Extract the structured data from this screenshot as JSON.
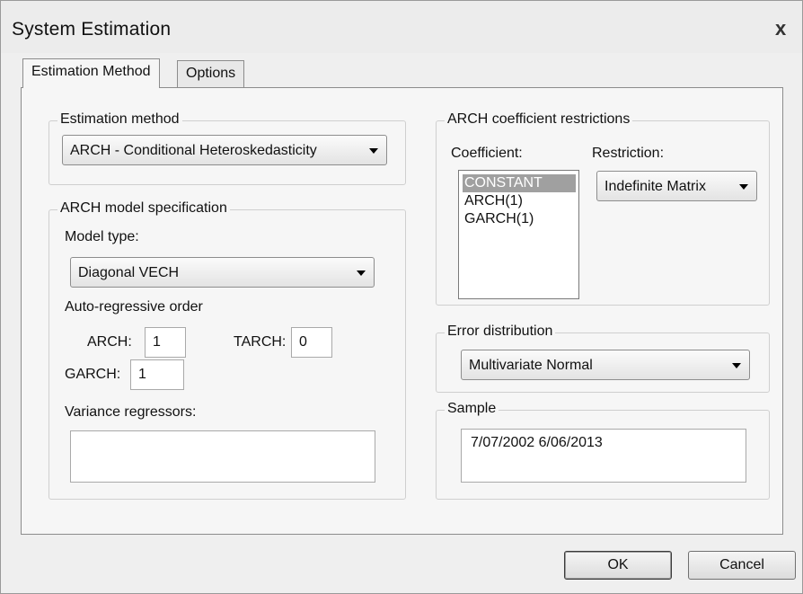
{
  "window": {
    "title": "System Estimation",
    "close_glyph": "x"
  },
  "tabs": [
    {
      "label": "Estimation Method",
      "active": true
    },
    {
      "label": "Options",
      "active": false
    }
  ],
  "estimation_method": {
    "legend": "Estimation method",
    "selected": "ARCH - Conditional Heteroskedasticity"
  },
  "arch_spec": {
    "legend": "ARCH model specification",
    "model_type_label": "Model type:",
    "model_type_selected": "Diagonal VECH",
    "ar_order_label": "Auto-regressive order",
    "arch_label": "ARCH:",
    "arch_value": "1",
    "tarch_label": "TARCH:",
    "tarch_value": "0",
    "garch_label": "GARCH:",
    "garch_value": "1",
    "variance_regressors_label": "Variance regressors:",
    "variance_regressors_value": ""
  },
  "arch_restrictions": {
    "legend": "ARCH coefficient restrictions",
    "coefficient_label": "Coefficient:",
    "restriction_label": "Restriction:",
    "coefficients": [
      "CONSTANT",
      "ARCH(1)",
      "GARCH(1)"
    ],
    "selected_coefficient": "CONSTANT",
    "restriction_selected": "Indefinite Matrix"
  },
  "error_distribution": {
    "legend": "Error distribution",
    "selected": "Multivariate Normal"
  },
  "sample": {
    "legend": "Sample",
    "value": "7/07/2002 6/06/2013"
  },
  "buttons": {
    "ok": "OK",
    "cancel": "Cancel"
  },
  "icons": {
    "close": "close-icon",
    "dropdown": "chevron-down-icon"
  }
}
